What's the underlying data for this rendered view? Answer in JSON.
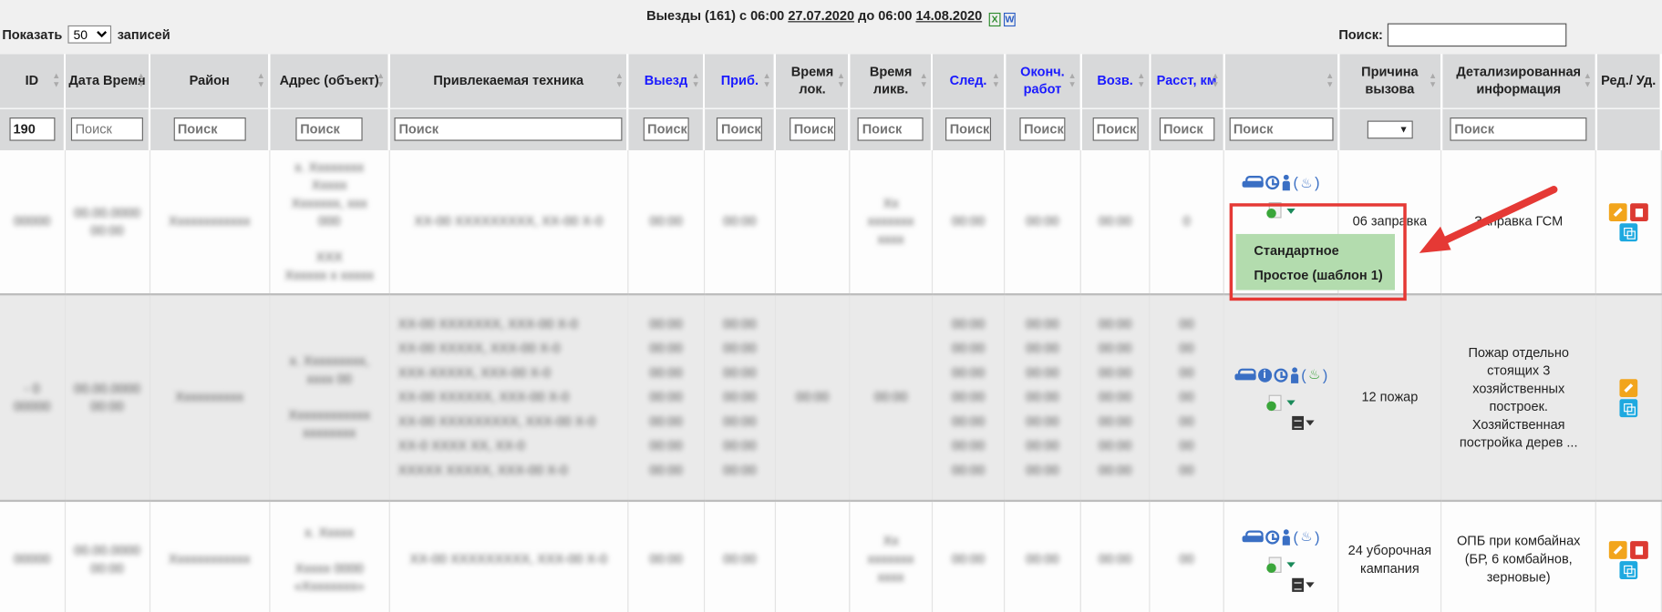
{
  "header": {
    "title_prefix": "Выезды (161) с 06:00",
    "date_from": "27.07.2020",
    "title_mid": "до 06:00",
    "date_to": "14.08.2020",
    "export_excel_icon": "excel-icon",
    "export_word_icon": "word-icon"
  },
  "length_control": {
    "prefix": "Показать",
    "value": "50",
    "suffix": "записей"
  },
  "search": {
    "label": "Поиск:",
    "value": ""
  },
  "columns": [
    {
      "label": "ID"
    },
    {
      "label": "Дата Время"
    },
    {
      "label": "Район"
    },
    {
      "label": "Адрес (объект)"
    },
    {
      "label": "Привлекаемая техника"
    },
    {
      "label": "Выезд",
      "color": "#1a1aff"
    },
    {
      "label": "Приб.",
      "color": "#1a1aff"
    },
    {
      "label": "Время лок."
    },
    {
      "label": "Время ликв."
    },
    {
      "label": "След.",
      "color": "#1a1aff"
    },
    {
      "label": "Оконч. работ",
      "color": "#1a1aff"
    },
    {
      "label": "Возв.",
      "color": "#1a1aff"
    },
    {
      "label": "Расст, км",
      "color": "#1a1aff"
    },
    {
      "label": ""
    },
    {
      "label": "Причина вызова"
    },
    {
      "label": "Детализированная информация"
    },
    {
      "label": "Ред./ Уд."
    }
  ],
  "filters": {
    "id_value": "190",
    "placeholder": "Поиск",
    "reason_select": ""
  },
  "rows": [
    {
      "reason": "06 заправка",
      "details": "Заправка ГСМ",
      "icons": [
        "car-icon",
        "clock-icon",
        "person-icon",
        "fire-icon"
      ]
    },
    {
      "reason": "12 пожар",
      "details_lines": [
        "Пожар отдельно",
        "стоящих 3",
        "хозяйственных",
        "построек.",
        "Хозяйственная",
        "постройка дерев ..."
      ],
      "icons": [
        "car-icon",
        "info-icon",
        "clock-icon",
        "person-icon",
        "fire-icon"
      ]
    },
    {
      "reason_lines": [
        "24 уборочная",
        "кампания"
      ],
      "details_lines": [
        "ОПБ при комбайнах",
        "(БР, 6 комбайнов,",
        "зерновые)"
      ],
      "icons": [
        "car-icon",
        "clock-icon",
        "person-icon",
        "fire-icon"
      ]
    }
  ],
  "dropdown": {
    "items": [
      "Стандартное",
      "Простое (шаблон 1)"
    ],
    "background": "#b3dcae"
  },
  "annotation": {
    "highlight_color": "#e53935"
  }
}
